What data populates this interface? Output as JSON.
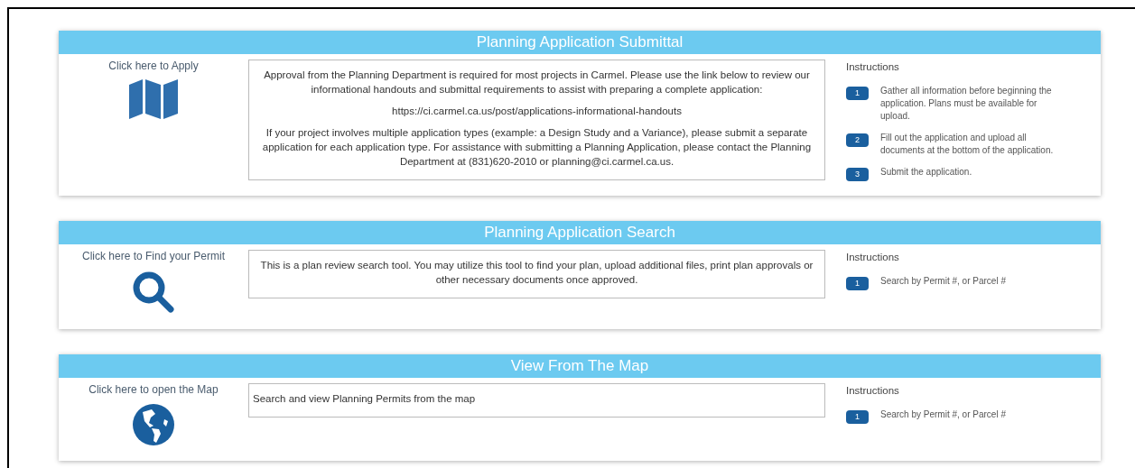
{
  "sections": [
    {
      "title": "Planning Application Submittal",
      "link": "Click here to Apply",
      "kind": "map",
      "centered": true,
      "paragraphs": [
        "Approval from the Planning Department is required for most projects in Carmel. Please use the link below to review our informational handouts and submittal requirements to assist with preparing a complete application:",
        "https://ci.carmel.ca.us/post/applications-informational-handouts",
        "If your project involves multiple application types (example: a Design Study and a Variance), please submit a separate application for each application type. For assistance with submitting a Planning Application, please contact the Planning Department at (831)620-2010 or planning@ci.carmel.ca.us."
      ],
      "instructions_heading": "Instructions",
      "steps": [
        {
          "number": "1",
          "text": "Gather all information before beginning the application. Plans must be available for upload."
        },
        {
          "number": "2",
          "text": "Fill out the application and upload all documents at the bottom of the application."
        },
        {
          "number": "3",
          "text": "Submit the application."
        }
      ]
    },
    {
      "title": "Planning Application Search",
      "link": "Click here to Find your Permit",
      "kind": "search",
      "centered": true,
      "paragraphs": [
        "This is a plan review search tool. You may utilize this tool to find your plan, upload additional files, print plan approvals or other necessary documents once approved."
      ],
      "instructions_heading": "Instructions",
      "steps": [
        {
          "number": "1",
          "text": "Search by Permit #, or Parcel #"
        }
      ]
    },
    {
      "title": "View From The Map",
      "link": "Click here to open the Map",
      "kind": "globe",
      "centered": false,
      "paragraphs": [
        "Search and view Planning Permits from the map"
      ],
      "instructions_heading": "Instructions",
      "steps": [
        {
          "number": "1",
          "text": "Search by Permit #, or Parcel #"
        }
      ]
    }
  ]
}
